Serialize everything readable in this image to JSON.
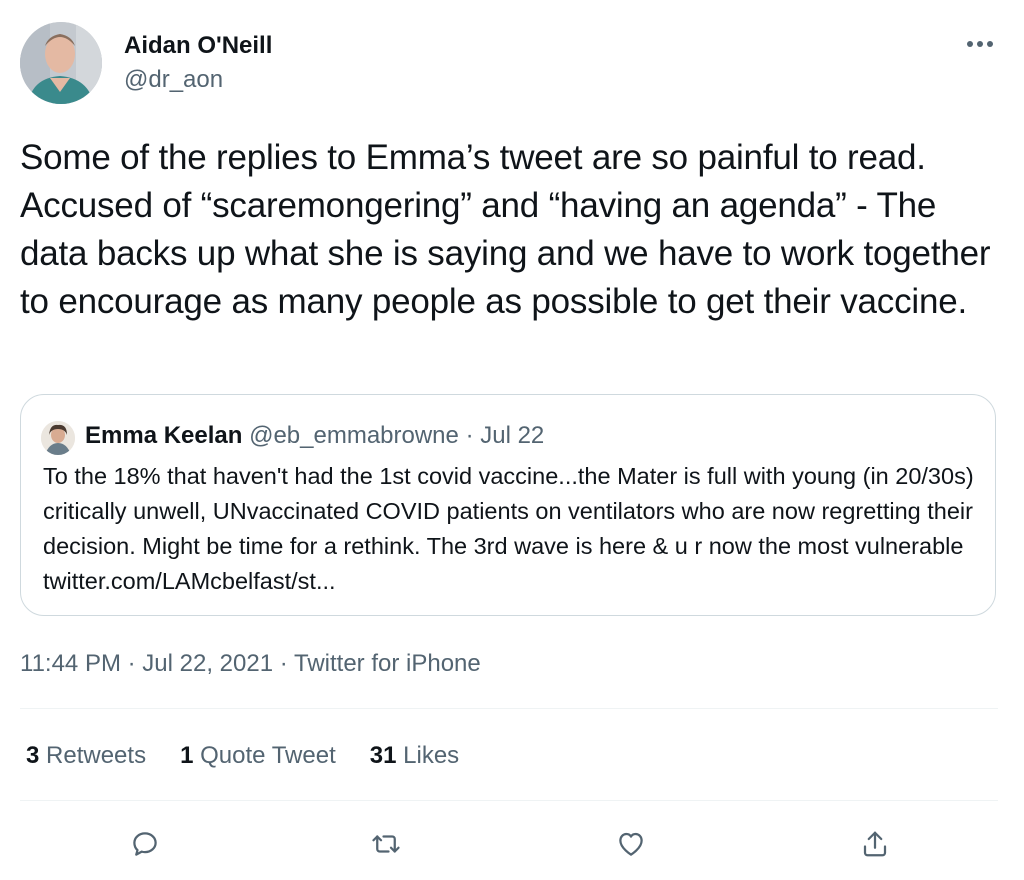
{
  "author": {
    "name": "Aidan O'Neill",
    "handle": "@dr_aon"
  },
  "tweet": {
    "text": "Some of the replies to Emma’s tweet are so painful to read. Accused of “scaremongering” and “having an agenda” - The data backs up what she is saying and we have to work together to encourage as many people as possible to get their vaccine."
  },
  "quote": {
    "name": "Emma Keelan",
    "handle": "@eb_emmabrowne",
    "separator": "·",
    "date": "Jul 22",
    "text": "To the 18% that haven't had the 1st covid vaccine...the Mater is full with young (in 20/30s) critically unwell, UNvaccinated COVID patients on ventilators who are now regretting their decision. Might be time for a rethink. The 3rd wave is here & u r now the most vulnerable twitter.com/LAMcbelfast/st..."
  },
  "meta": {
    "time": "11:44 PM",
    "date": "Jul 22, 2021",
    "source": "Twitter for iPhone",
    "separator": "·"
  },
  "stats": {
    "retweets_count": "3",
    "retweets_label": "Retweets",
    "quotes_count": "1",
    "quotes_label": "Quote Tweet",
    "likes_count": "31",
    "likes_label": "Likes"
  },
  "icons": {
    "more": "more-horizontal-icon",
    "reply": "reply-icon",
    "retweet": "retweet-icon",
    "like": "heart-icon",
    "share": "share-icon"
  },
  "colors": {
    "text_primary": "#0f1419",
    "text_secondary": "#536471",
    "border": "#cfd9de",
    "divider": "#eff3f4"
  }
}
